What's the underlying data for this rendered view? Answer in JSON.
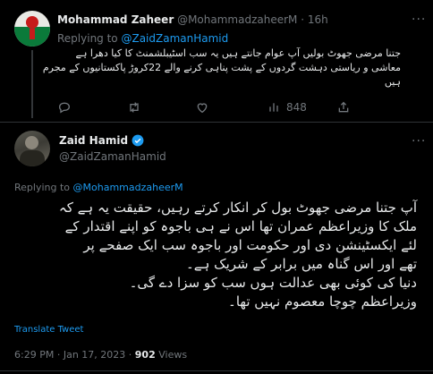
{
  "reply_tweet": {
    "name": "Mohammad Zaheer",
    "handle": "@MohammadzaheerM",
    "time": "16h",
    "replying_label": "Replying to",
    "replying_handle": "@ZaidZamanHamid",
    "text_lines": [
      "جتنا مرضی جھوٹ بولیں آپ عوام جانتے ہیں یہ سب اسٹیبلشمنٹ کا کیا دھرا ہے",
      "معاشی و ریاستی دہشت گردوں کے پشت پناہی کرنے والے 22کروڑ پاکستانیوں کے مجرم",
      "ہیں"
    ],
    "actions": {
      "views": "848"
    },
    "icons": {
      "more": "more-icon",
      "reply": "reply-icon",
      "retweet": "retweet-icon",
      "like": "like-icon",
      "views": "views-icon",
      "share": "share-icon"
    }
  },
  "main_tweet": {
    "name": "Zaid Hamid",
    "verified": true,
    "handle": "@ZaidZamanHamid",
    "replying_label": "Replying to",
    "replying_handle": "@MohammadzaheerM",
    "text_lines": [
      "آپ جتنا مرضی جھوٹ بول کر انکار کرتے رہیں، حقیقت یہ ہے کہ",
      "ملک کا وزیراعظم عمران تھا اس نے ہی باجوہ کو اپنے اقتدار کے",
      "لئے ایکسٹینشن دی اور حکومت اور باجوہ سب ایک صفحے پر",
      "تھے اور اس گناہ میں برابر کے شریک ہے۔",
      "دنیا کی کوئی بھی عدالت ہوں سب کو سزا دے گی۔",
      "وزیراعظم چوچا معصوم نہیں تھا۔"
    ],
    "translate_label": "Translate Tweet",
    "time": "6:29 PM",
    "date": "Jan 17, 2023",
    "separator": "·",
    "views_count": "902",
    "views_label": "Views"
  },
  "colors": {
    "background": "#000000",
    "text": "#e7e9ea",
    "muted": "#71767b",
    "accent": "#1d9bf0",
    "divider": "#2f3336"
  }
}
